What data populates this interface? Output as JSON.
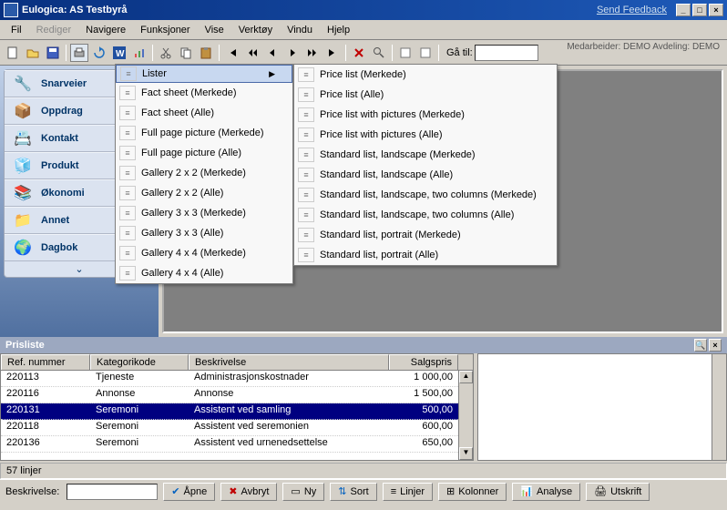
{
  "title": "Eulogica: AS Testbyrå",
  "feedback_link": "Send Feedback",
  "menus": {
    "fil": "Fil",
    "rediger": "Rediger",
    "navigere": "Navigere",
    "funksjoner": "Funksjoner",
    "vise": "Vise",
    "verktoy": "Verktøy",
    "vindu": "Vindu",
    "hjelp": "Hjelp"
  },
  "staff_info": "Medarbeider: DEMO   Avdeling: DEMO",
  "goto_label": "Gå til:",
  "sidebar": {
    "items": [
      {
        "label": "Snarveier"
      },
      {
        "label": "Oppdrag"
      },
      {
        "label": "Kontakt"
      },
      {
        "label": "Produkt"
      },
      {
        "label": "Økonomi"
      },
      {
        "label": "Annet"
      },
      {
        "label": "Dagbok"
      }
    ]
  },
  "dropdown1": {
    "header": "Lister",
    "items": [
      "Fact sheet (Merkede)",
      "Fact sheet (Alle)",
      "Full page picture (Merkede)",
      "Full page picture (Alle)",
      "Gallery 2 x 2 (Merkede)",
      "Gallery 2 x 2 (Alle)",
      "Gallery 3 x 3 (Merkede)",
      "Gallery 3 x 3 (Alle)",
      "Gallery 4 x 4 (Merkede)",
      "Gallery 4 x 4 (Alle)"
    ]
  },
  "dropdown2": {
    "items": [
      "Price list (Merkede)",
      "Price list (Alle)",
      "Price list with pictures (Merkede)",
      "Price list with pictures (Alle)",
      "Standard list, landscape (Merkede)",
      "Standard list, landscape (Alle)",
      "Standard list, landscape, two columns (Merkede)",
      "Standard list, landscape, two columns (Alle)",
      "Standard list, portrait (Merkede)",
      "Standard list, portrait (Alle)"
    ]
  },
  "prisliste": {
    "title": "Prisliste",
    "cols": {
      "c1": "Ref. nummer",
      "c2": "Kategorikode",
      "c3": "Beskrivelse",
      "c4": "Salgspris"
    },
    "rows": [
      {
        "c1": "220113",
        "c2": "Tjeneste",
        "c3": "Administrasjonskostnader",
        "c4": "1 000,00"
      },
      {
        "c1": "220116",
        "c2": "Annonse",
        "c3": "Annonse",
        "c4": "1 500,00"
      },
      {
        "c1": "220131",
        "c2": "Seremoni",
        "c3": "Assistent ved samling",
        "c4": "500,00"
      },
      {
        "c1": "220118",
        "c2": "Seremoni",
        "c3": "Assistent ved seremonien",
        "c4": "600,00"
      },
      {
        "c1": "220136",
        "c2": "Seremoni",
        "c3": "Assistent ved urnenedsettelse",
        "c4": "650,00"
      }
    ],
    "status": "57 linjer",
    "desc_label": "Beskrivelse:",
    "buttons": {
      "apne": "Åpne",
      "avbryt": "Avbryt",
      "ny": "Ny",
      "sort": "Sort",
      "linjer": "Linjer",
      "kolonner": "Kolonner",
      "analyse": "Analyse",
      "utskrift": "Utskrift"
    }
  }
}
